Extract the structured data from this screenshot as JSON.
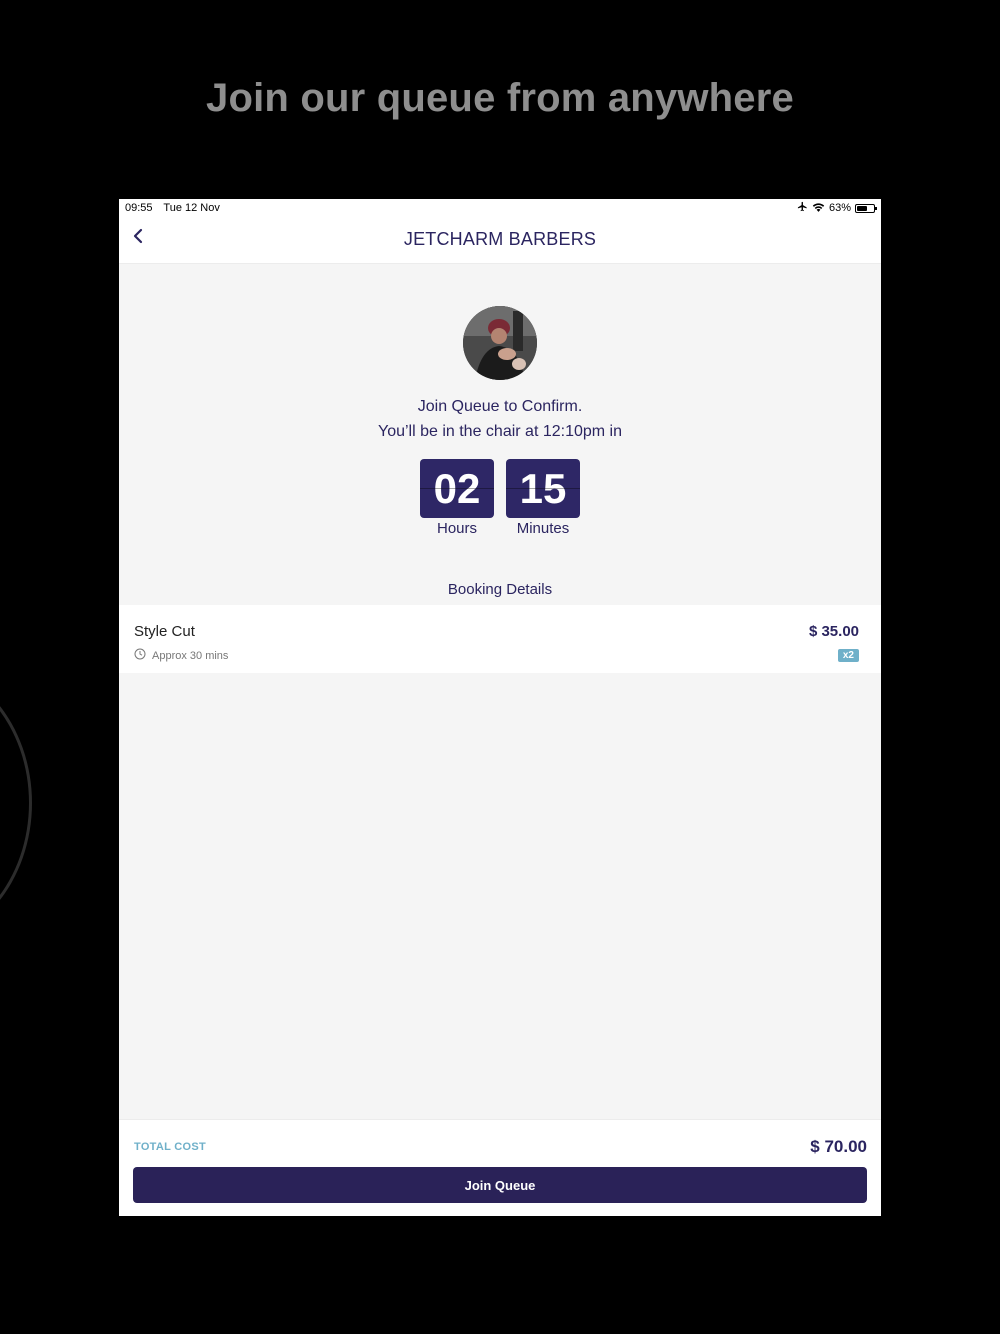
{
  "promo": {
    "heading": "Join our queue from anywhere"
  },
  "status_bar": {
    "time": "09:55",
    "date": "Tue 12 Nov",
    "battery": "63%",
    "battery_level": 0.63
  },
  "nav": {
    "title": "JETCHARM BARBERS",
    "back_icon": "chevron-left-icon"
  },
  "confirm": {
    "line1": "Join Queue to Confirm.",
    "line2": "You’ll be in the chair at 12:10pm in"
  },
  "countdown": {
    "hours_value": "02",
    "hours_label": "Hours",
    "minutes_value": "15",
    "minutes_label": "Minutes"
  },
  "booking": {
    "section_title": "Booking Details",
    "items": [
      {
        "name": "Style Cut",
        "duration": "Approx 30 mins",
        "price": "$ 35.00",
        "quantity": "x2"
      }
    ]
  },
  "footer": {
    "total_label": "TOTAL COST",
    "total_value": "$ 70.00",
    "join_button": "Join Queue"
  },
  "colors": {
    "brand": "#2a2258",
    "accent": "#6fb0c9",
    "background": "#f5f5f5"
  }
}
